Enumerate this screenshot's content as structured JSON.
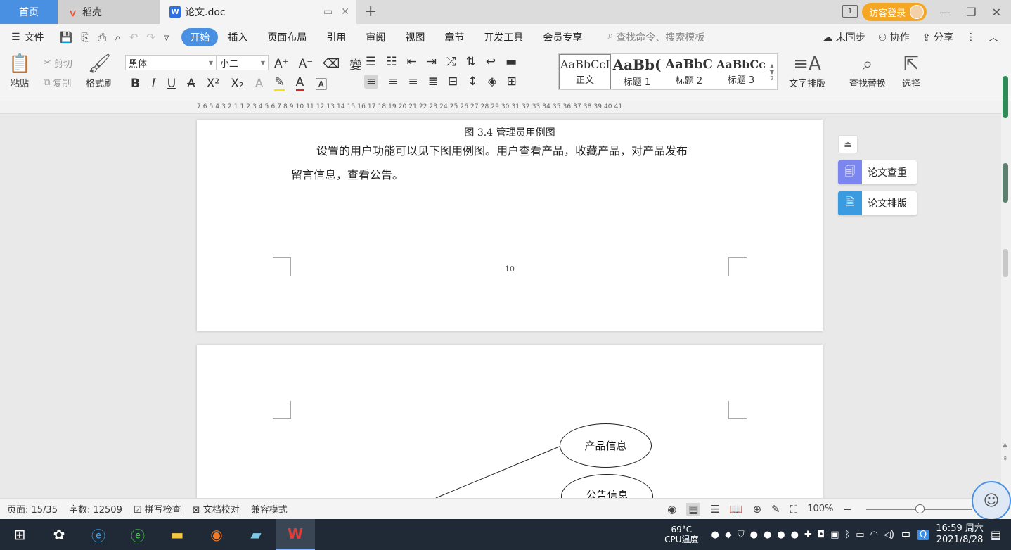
{
  "tabs": {
    "home": "首页",
    "daoke": "稻壳",
    "doc": "论文.doc",
    "doc_icon": "W",
    "visitor_login": "访客登录",
    "schedule_badge": "1"
  },
  "menu": {
    "file": "文件",
    "items": [
      "开始",
      "插入",
      "页面布局",
      "引用",
      "审阅",
      "视图",
      "章节",
      "开发工具",
      "会员专享"
    ],
    "search": "查找命令、搜索模板",
    "unsynced": "未同步",
    "collab": "协作",
    "share": "分享"
  },
  "ribbon": {
    "paste": "粘贴",
    "cut": "剪切",
    "copy": "复制",
    "format_painter": "格式刷",
    "font_name": "黑体",
    "font_size": "小二",
    "styles": [
      {
        "preview": "AaBbCcI",
        "name": "正文"
      },
      {
        "preview": "AaBb(",
        "name": "标题 1"
      },
      {
        "preview": "AaBbC",
        "name": "标题 2"
      },
      {
        "preview": "AaBbCcl",
        "name": "标题 3"
      }
    ],
    "text_layout": "文字排版",
    "find_replace": "查找替换",
    "select": "选择"
  },
  "ruler": {
    "numbers": "7 6 5 4 3 2 1 1 2 3 4 5 6 7 8 9 10 11 12 13 14 15 16 17 18 19 20 21 22 23 24 25 26 27 28 29 30 31 32 33 34 35 36 37 38 39 40 41"
  },
  "document": {
    "caption": "图 3.4  管理员用例图",
    "para_line1": "设置的用户功能可以见下图用例图。用户查看产品，收藏产品，对产品发布",
    "para_line2": "留言信息，查看公告。",
    "page_number": "10",
    "ellipse1": "产品信息",
    "ellipse2": "公告信息"
  },
  "side_panel": {
    "check": "论文查重",
    "layout": "论文排版"
  },
  "status": {
    "page": "页面: 15/35",
    "words": "字数: 12509",
    "spell": "拼写检查",
    "proof": "文档校对",
    "compat": "兼容模式",
    "zoom": "100%"
  },
  "taskbar": {
    "cpu_temp": "69°C",
    "cpu_label": "CPU温度",
    "ime": "中",
    "time": "16:59 周六",
    "date": "2021/8/28"
  },
  "colors": {
    "accent": "#4a90e2",
    "visitor": "#f5a623"
  }
}
